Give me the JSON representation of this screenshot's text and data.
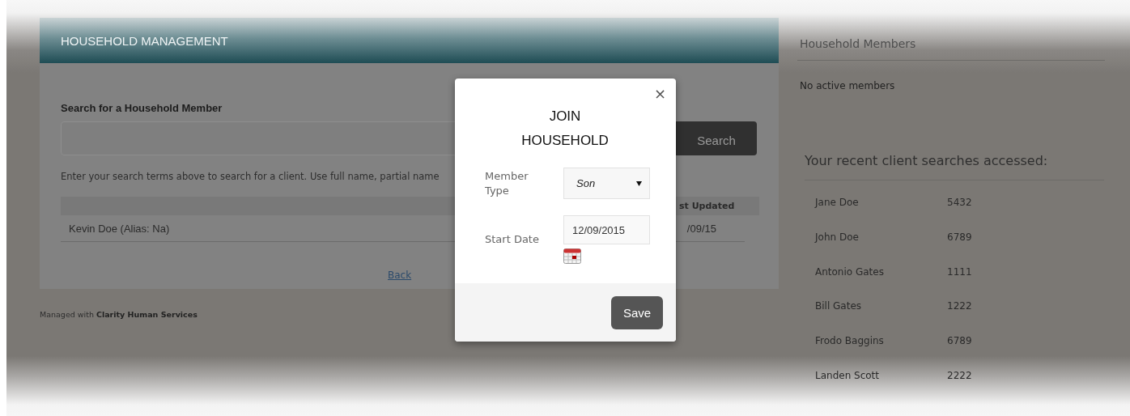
{
  "household_management": {
    "title": "HOUSEHOLD MANAGEMENT",
    "search": {
      "heading": "Search for a Household Member",
      "button": "Search",
      "hint": "Enter your search terms above to search for a client. Use full name, partial name"
    },
    "results": {
      "columns": [
        "",
        "st Updated"
      ],
      "rows": [
        {
          "name": "Kevin Doe (Alias: Na)",
          "updated": "/09/15"
        }
      ]
    },
    "back_link": "Back"
  },
  "footer": "Managed with **Clarity Human Services**",
  "household_members": {
    "title": "Household Members",
    "empty_text": "No active members"
  },
  "recent_searches": {
    "title": "Your recent client searches accessed:",
    "rows": [
      {
        "name": "Jane Doe",
        "id": "5432"
      },
      {
        "name": "John Doe",
        "id": "6789"
      },
      {
        "name": "Antonio Gates",
        "id": "1111"
      },
      {
        "name": "Bill Gates",
        "id": "1222"
      },
      {
        "name": "Frodo Baggins",
        "id": "6789"
      },
      {
        "name": "Landen Scott",
        "id": "2222"
      }
    ]
  },
  "dialog": {
    "close": "×",
    "title": "JOIN HOUSEHOLD",
    "fields": [
      {
        "kind": "select",
        "label": "Member Type",
        "value": "Son"
      },
      {
        "kind": "date",
        "label": "Start Date",
        "value": "12/09/2015"
      }
    ],
    "save_button": "Save"
  }
}
